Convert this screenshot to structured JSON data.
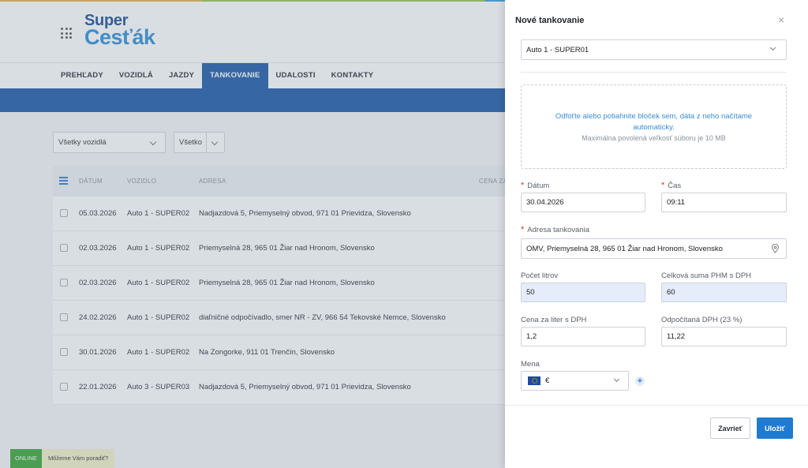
{
  "app": {
    "logo_line1": "Super",
    "logo_line2": "Cesťák",
    "nav": [
      "PREHĽADY",
      "VOZIDLÁ",
      "JAZDY",
      "TANKOVANIE",
      "UDALOSTI",
      "KONTAKTY"
    ],
    "active_nav": "TANKOVANIE",
    "filters": {
      "vehicles": "Všetky vozidlá",
      "scope": "Všetko"
    },
    "table": {
      "headers": [
        "DÁTUM",
        "VOZIDLO",
        "ADRESA",
        "CENA ZA"
      ],
      "rows": [
        {
          "date": "05.03.2026",
          "vehicle": "Auto 1 - SUPER02",
          "address": "Nadjazdová 5, Priemyselný obvod, 971 01 Prievidza, Slovensko"
        },
        {
          "date": "02.03.2026",
          "vehicle": "Auto 1 - SUPER02",
          "address": "Priemyselná 28, 965 01 Žiar nad Hronom, Slovensko"
        },
        {
          "date": "02.03.2026",
          "vehicle": "Auto 1 - SUPER02",
          "address": "Priemyselná 28, 965 01 Žiar nad Hronom, Slovensko"
        },
        {
          "date": "24.02.2026",
          "vehicle": "Auto 1 - SUPER02",
          "address": "diaľničné odpočívadlo, smer NR - ZV, 966 54 Tekovské Nemce, Slovensko"
        },
        {
          "date": "30.01.2026",
          "vehicle": "Auto 1 - SUPER02",
          "address": "Na Zongorke, 911 01 Trenčín, Slovensko"
        },
        {
          "date": "22.01.2026",
          "vehicle": "Auto 3 - SUPER03",
          "address": "Nadjazdová 5, Priemyselný obvod, 971 01 Prievidza, Slovensko"
        }
      ]
    },
    "chat": {
      "status": "ONLINE",
      "prompt": "Môžeme Vám poradiť?"
    }
  },
  "panel": {
    "title": "Nové tankovanie",
    "close_symbol": "×",
    "vehicle": "Auto 1 - SUPER01",
    "dropzone_text": "Odfoťte alebo potiahnite bloček sem, dáta z neho načítame automaticky.",
    "dropzone_hint": "Maximálna povolená veľkosť súboru je 10 MB",
    "required_mark": "*",
    "date_label": "Dátum",
    "date_value": "30.04.2026",
    "time_label": "Čas",
    "time_value": "09:11",
    "address_label": "Adresa tankovania",
    "address_value": "OMV, Priemyselná 28, 965 01 Žiar nad Hronom, Slovensko",
    "liters_label": "Počet litrov",
    "liters_value": "50",
    "total_label": "Celková suma PHM s DPH",
    "total_value": "60",
    "unit_price_label": "Cena za liter s DPH",
    "unit_price_value": "1,2",
    "vat_label": "Odpočítaná DPH (23 %)",
    "vat_value": "11,22",
    "currency_label": "Mena",
    "currency_value": "€",
    "plus_symbol": "+",
    "close_button": "Zavrieť",
    "save_button": "Uložiť"
  }
}
